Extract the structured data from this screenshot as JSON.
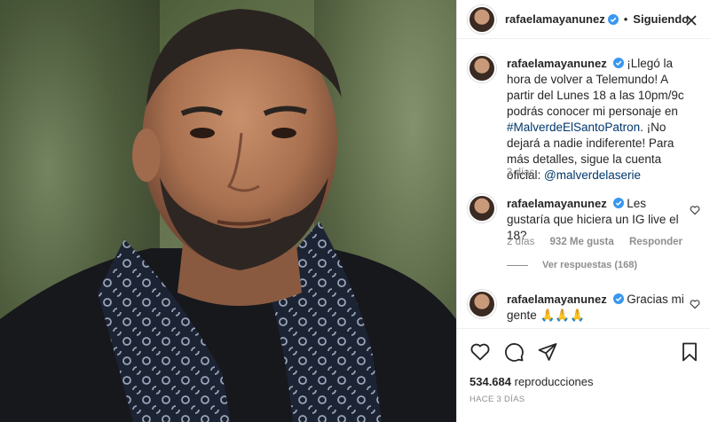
{
  "post": {
    "username": "rafaelamayanunez",
    "follow_status": "Siguiendo",
    "separator": "•"
  },
  "caption": {
    "username": "rafaelamayanunez",
    "text_1": "¡Llegó la hora de volver a Telemundo! A partir del Lunes 18 a las 10pm/9c podrás conocer mi personaje en ",
    "hashtag": "#MalverdeElSantoPatron",
    "text_2": ". ¡No dejará a nadie indiferente! Para más detalles, sigue la cuenta oficial: ",
    "mention": "@malverdelaserie",
    "time": "3 días"
  },
  "comments": [
    {
      "username": "rafaelamayanunez",
      "text": "Les gustaría que hiciera un IG live el 18?",
      "time": "2 días",
      "likes": "932 Me gusta",
      "reply": "Responder",
      "view_replies": "Ver respuestas (168)"
    },
    {
      "username": "rafaelamayanunez",
      "text": "Gracias mi gente 🙏🙏🙏"
    }
  ],
  "stats": {
    "views_count": "534.684",
    "views_label": "reproducciones",
    "posted": "HACE 3 DÍAS"
  },
  "icons": {
    "like": "heart-icon",
    "comment": "comment-icon",
    "share": "share-icon",
    "save": "bookmark-icon",
    "more": "more-options-icon",
    "verified": "verified-badge-icon"
  },
  "colors": {
    "verified": "#3897f0",
    "link": "#00376b",
    "muted": "#8e8e8e",
    "text": "#262626"
  }
}
